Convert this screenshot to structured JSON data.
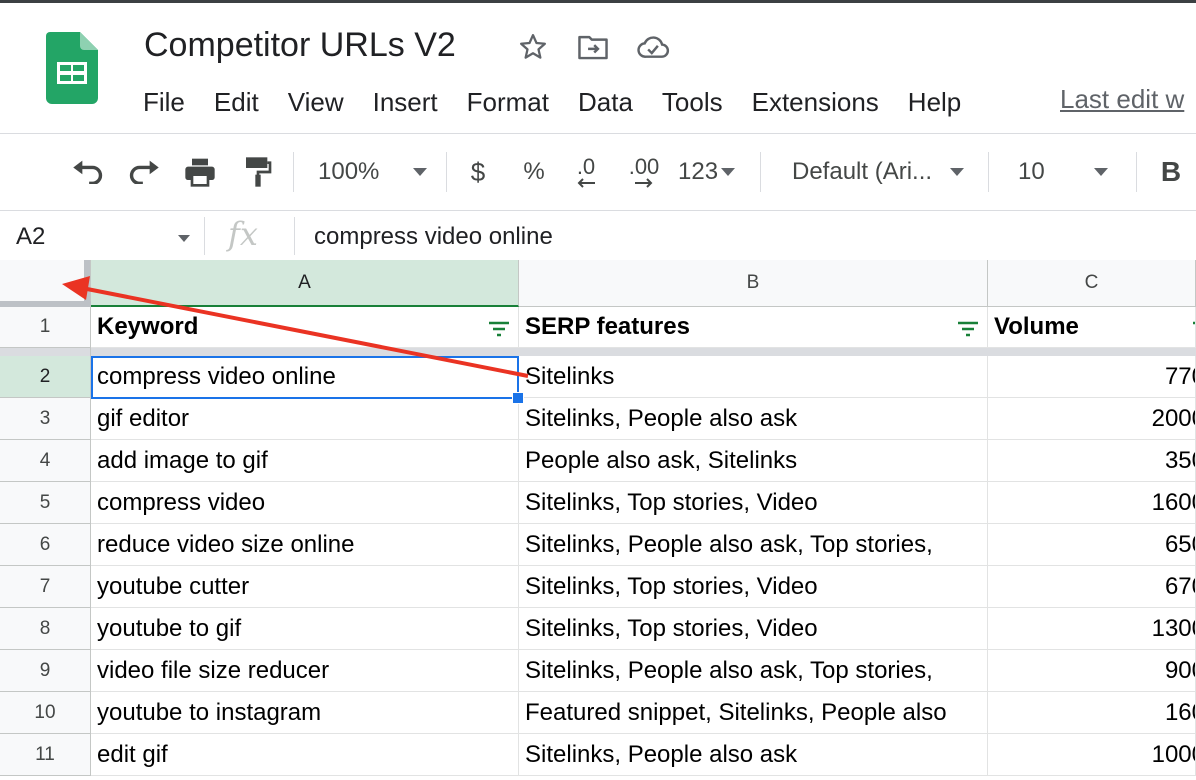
{
  "app": {
    "doc_title": "Competitor URLs V2",
    "last_edit": "Last edit w",
    "menu": [
      "File",
      "Edit",
      "View",
      "Insert",
      "Format",
      "Data",
      "Tools",
      "Extensions",
      "Help"
    ]
  },
  "toolbar": {
    "zoom": "100%",
    "currency": "$",
    "percent": "%",
    "decrease_decimal": ".0",
    "increase_decimal": ".00",
    "more_formats": "123",
    "font": "Default (Ari...",
    "font_size": "10",
    "bold": "B"
  },
  "formula_bar": {
    "name_box": "A2",
    "fx": "fx",
    "value": "compress video online"
  },
  "grid": {
    "columns": [
      "A",
      "B",
      "C"
    ],
    "selected_column": "A",
    "selected_row": "2",
    "row_numbers": [
      "1",
      "2",
      "3",
      "4",
      "5",
      "6",
      "7",
      "8",
      "9",
      "10",
      "11"
    ],
    "header": [
      "Keyword",
      "SERP features",
      "Volume"
    ],
    "rows": [
      [
        "compress video online",
        "Sitelinks",
        "770"
      ],
      [
        "gif editor",
        "Sitelinks, People also ask",
        "2000"
      ],
      [
        "add image to gif",
        "People also ask, Sitelinks",
        "350"
      ],
      [
        "compress video",
        "Sitelinks, Top stories, Video",
        "1600"
      ],
      [
        "reduce video size online",
        "Sitelinks, People also ask, Top stories,",
        "650"
      ],
      [
        "youtube cutter",
        "Sitelinks, Top stories, Video",
        "670"
      ],
      [
        "youtube to gif",
        "Sitelinks, Top stories, Video",
        "1300"
      ],
      [
        "video file size reducer",
        "Sitelinks, People also ask, Top stories,",
        "900"
      ],
      [
        "youtube to instagram",
        "Featured snippet, Sitelinks, People also",
        "160"
      ],
      [
        "edit gif",
        "Sitelinks, People also ask",
        "1000"
      ]
    ]
  },
  "colors": {
    "sheets_green": "#0f9d58",
    "selection_blue": "#1a73e8",
    "header_selected": "#d3e8dc",
    "annotation_arrow": "#ea3323"
  }
}
